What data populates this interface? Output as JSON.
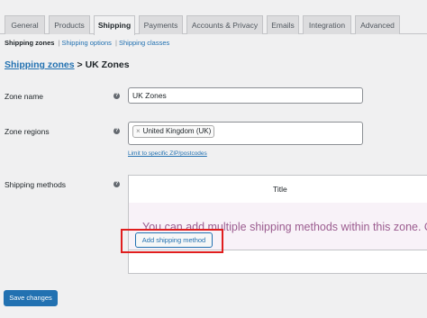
{
  "tabs": [
    {
      "label": "General",
      "active": false
    },
    {
      "label": "Products",
      "active": false
    },
    {
      "label": "Shipping",
      "active": true
    },
    {
      "label": "Payments",
      "active": false
    },
    {
      "label": "Accounts & Privacy",
      "active": false
    },
    {
      "label": "Emails",
      "active": false
    },
    {
      "label": "Integration",
      "active": false
    },
    {
      "label": "Advanced",
      "active": false
    }
  ],
  "subnav": {
    "current": "Shipping zones",
    "options": "Shipping options",
    "classes": "Shipping classes",
    "separator": "|"
  },
  "breadcrumb": {
    "link": "Shipping zones",
    "separator": ">",
    "current": "UK Zones"
  },
  "zone_name": {
    "label": "Zone name",
    "value": "UK Zones"
  },
  "zone_regions": {
    "label": "Zone regions",
    "chip_remove": "×",
    "chip": "United Kingdom (UK)",
    "limit_link": "Limit to specific ZIP/postcodes"
  },
  "shipping_methods": {
    "label": "Shipping methods",
    "column_title": "Title",
    "blank_message": "You can add multiple shipping methods within this zone. O",
    "add_button": "Add shipping method"
  },
  "help_icon_glyph": "?",
  "save_button": "Save changes",
  "colors": {
    "accent": "#2271b1",
    "highlight": "#e01e1e",
    "blank_text": "#9b5c8f",
    "blank_bg": "#f8f2f8",
    "page_bg": "#f0f0f1"
  }
}
